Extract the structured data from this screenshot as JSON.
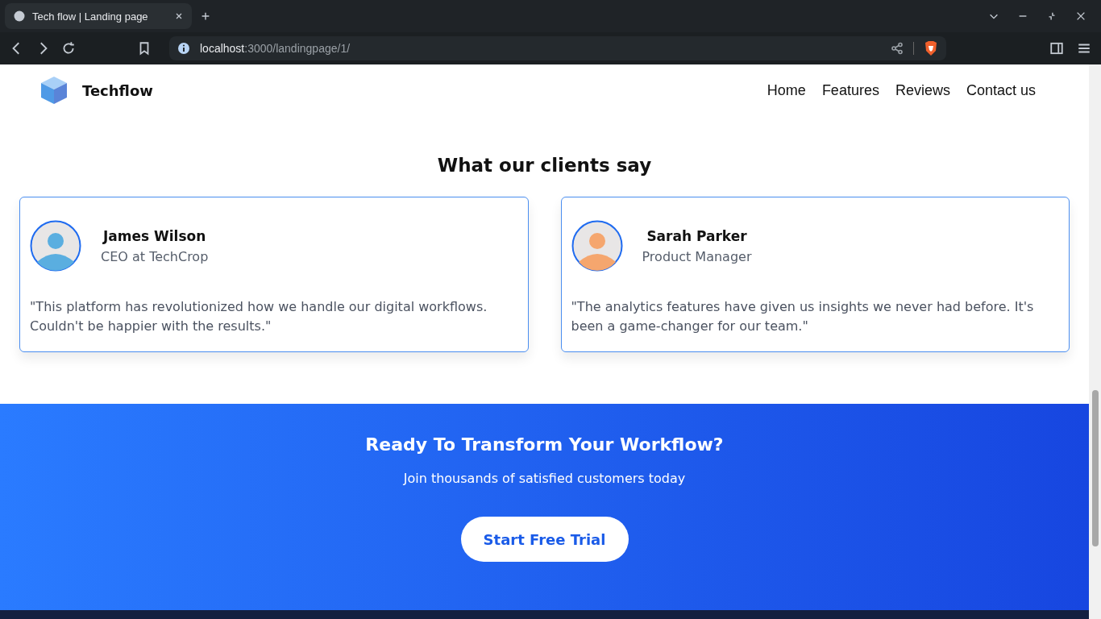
{
  "browser": {
    "tab_title": "Tech flow | Landing page",
    "url_host": "localhost",
    "url_path": ":3000/landingpage/1/"
  },
  "header": {
    "brand": "Techflow",
    "nav": [
      "Home",
      "Features",
      "Reviews",
      "Contact us"
    ]
  },
  "testimonials": {
    "heading": "What our clients say",
    "items": [
      {
        "name": "James Wilson",
        "role": "CEO at TechCrop",
        "quote": "\"This platform has revolutionized how we handle our digital workflows. Couldn't be happier with the results.\"",
        "color": "#5aaee0"
      },
      {
        "name": "Sarah Parker",
        "role": "Product Manager",
        "quote": "\"The analytics features have given us insights we never had before. It's been a game-changer for our team.\"",
        "color": "#f5a66e"
      }
    ]
  },
  "cta": {
    "heading": "Ready To Transform Your Workflow?",
    "subtitle": "Join thousands of satisfied customers today",
    "button": "Start Free Trial"
  }
}
